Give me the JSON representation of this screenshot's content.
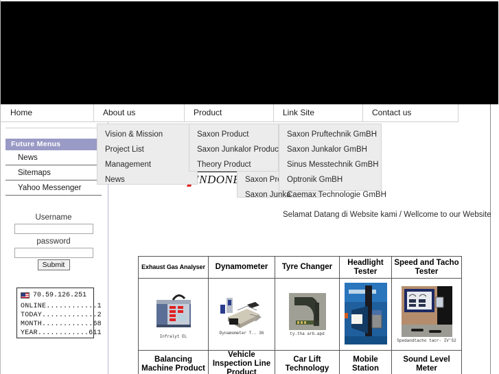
{
  "banner": {
    "alt": "site-header-banner",
    "background": "#000000"
  },
  "nav": {
    "items": [
      {
        "label": "Home",
        "name": "nav-home"
      },
      {
        "label": "About us",
        "name": "nav-about-us"
      },
      {
        "label": "Product",
        "name": "nav-product"
      },
      {
        "label": "Link Site",
        "name": "nav-link-site"
      },
      {
        "label": "Contact us",
        "name": "nav-contact-us"
      }
    ]
  },
  "dropdowns": {
    "about": {
      "items": [
        "Vision & Mission",
        "Project List",
        "Management",
        "News"
      ]
    },
    "product": {
      "items": [
        "Saxon Product",
        "Saxon Junkalor Product",
        "Theory Product"
      ]
    },
    "product_sub": {
      "items": [
        "Saxon Produ",
        "Saxon Junka"
      ]
    },
    "link_site": {
      "items": [
        "Saxon Pruftechnik GmBH",
        "Saxon Junkalor GmBH",
        "Sinus Messtechnik GmBH",
        "Optronik GmBH",
        "Caemax Technologie GmBH"
      ]
    }
  },
  "sidebar": {
    "heading": "Future Menus",
    "heading_color": "#9a9ac6",
    "items": [
      {
        "label": "News"
      },
      {
        "label": "Sitemaps"
      },
      {
        "label": "Yahoo Messenger"
      }
    ]
  },
  "login": {
    "username_label": "Username",
    "username_value": "",
    "username_placeholder": "",
    "password_label": "password",
    "password_value": "",
    "password_placeholder": "",
    "submit_label": "Submit"
  },
  "counter": {
    "ip": "70.59.126.251",
    "flag_icon": "us-flag-icon",
    "rows": [
      {
        "label": "ONLINE",
        "dots": "............",
        "value": "1"
      },
      {
        "label": "TODAY",
        "dots": ".............",
        "value": "2"
      },
      {
        "label": "MONTH",
        "dots": "............",
        "value": "68"
      },
      {
        "label": "YEAR",
        "dots": "............",
        "value": "611"
      }
    ]
  },
  "logo": {
    "text": "INDONE",
    "name": "company-logo"
  },
  "welcome": {
    "text": "Selamat Datang di Website kami / Wellcome to our Website"
  },
  "product_table": {
    "headers": [
      "Exhaust Gas Analyser",
      "Dynamometer",
      "Tyre Changer",
      "Headlight Tester",
      "Speed and Tacho Tester"
    ],
    "captions": [
      "Infralyt EL",
      "Dynamometer T.. 36",
      "ty.tha arb.apd",
      "",
      "Spedandtacho tacr- IV'52"
    ],
    "footers": [
      "Balancing Machine Product",
      "Vehicle Inspection Line Product",
      "Car Lift Technology",
      "Mobile Station",
      "Sound Level Meter"
    ]
  }
}
